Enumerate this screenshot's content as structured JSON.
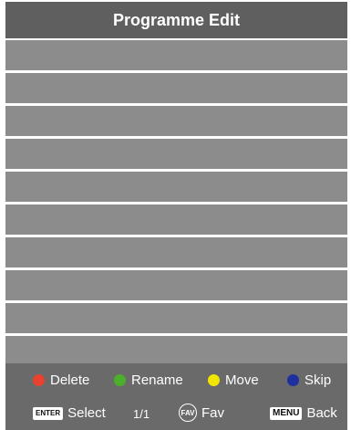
{
  "header": {
    "title": "Programme Edit"
  },
  "list": {
    "rows": [
      "",
      "",
      "",
      "",
      "",
      "",
      "",
      "",
      "",
      ""
    ]
  },
  "footer": {
    "colors": {
      "red": "#e8422f",
      "green": "#4caf2a",
      "yellow": "#f2e600",
      "blue": "#1f2f9e"
    },
    "actions": [
      {
        "key": "red",
        "label": "Delete"
      },
      {
        "key": "green",
        "label": "Rename"
      },
      {
        "key": "yellow",
        "label": "Move"
      },
      {
        "key": "blue",
        "label": "Skip"
      }
    ],
    "enter_key": "ENTER",
    "select_label": "Select",
    "page_indicator": "1/1",
    "fav_key": "FAV",
    "fav_label": "Fav",
    "menu_key": "MENU",
    "back_label": "Back"
  }
}
